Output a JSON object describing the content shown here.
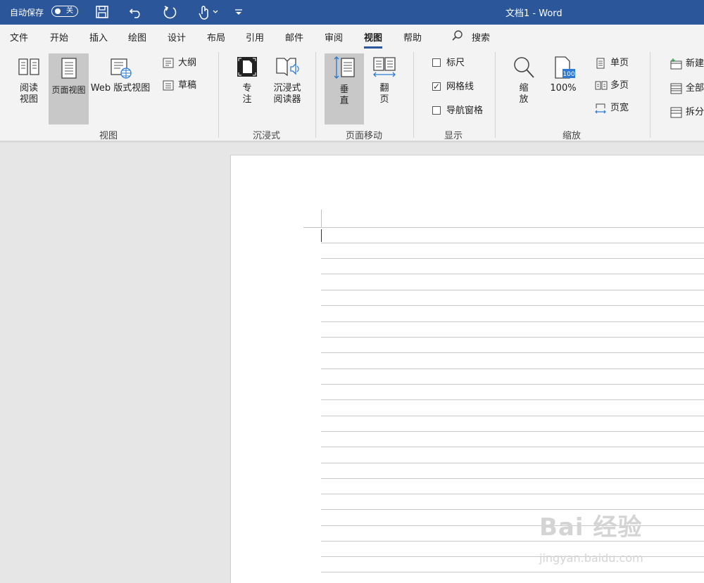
{
  "titlebar": {
    "autosave_label": "自动保存",
    "autosave_state": "关",
    "doc_title": "文档1  -  Word"
  },
  "tabs": [
    {
      "label": "文件"
    },
    {
      "label": "开始"
    },
    {
      "label": "插入"
    },
    {
      "label": "绘图"
    },
    {
      "label": "设计"
    },
    {
      "label": "布局"
    },
    {
      "label": "引用"
    },
    {
      "label": "邮件"
    },
    {
      "label": "审阅"
    },
    {
      "label": "视图",
      "active": true
    },
    {
      "label": "帮助"
    }
  ],
  "search": {
    "label": "搜索"
  },
  "ribbon": {
    "views": {
      "read_mode": "阅读\n视图",
      "print_layout": "页面视图",
      "web_layout": "Web 版式视图",
      "outline": "大纲",
      "draft": "草稿",
      "group_label": "视图"
    },
    "immersive": {
      "focus": "专\n注",
      "reader": "沉浸式\n阅读器",
      "group_label": "沉浸式"
    },
    "page_movement": {
      "vertical": "垂\n直",
      "side_to_side": "翻\n页",
      "group_label": "页面移动"
    },
    "show": {
      "ruler": "标尺",
      "ruler_checked": false,
      "gridlines": "网格线",
      "gridlines_checked": true,
      "nav_pane": "导航窗格",
      "nav_pane_checked": false,
      "group_label": "显示"
    },
    "zoom": {
      "zoom": "缩\n放",
      "hundred": "100%",
      "one_page": "单页",
      "multiple_pages": "多页",
      "page_width": "页宽",
      "group_label": "缩放"
    },
    "window": {
      "new_window": "新建",
      "arrange_all": "全部",
      "split": "拆分"
    }
  },
  "watermark": {
    "main": "Bai 经验",
    "sub": "jingyan.baidu.com"
  },
  "colors": {
    "titlebar": "#2b579a",
    "ribbon_bg": "#f3f3f3",
    "selected_btn": "#c8c8c8",
    "accent_blue": "#2b7bd6"
  }
}
